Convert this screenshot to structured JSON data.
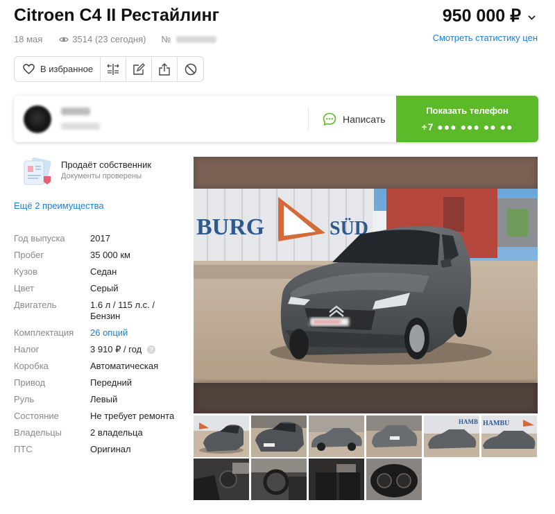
{
  "listing": {
    "title": "Citroen C4 II Рестайлинг",
    "price": "950 000 ₽",
    "price_stats_link": "Смотреть статистику цен",
    "date": "18 мая",
    "views": "3514 (23 сегодня)",
    "number_prefix": "№"
  },
  "actions": {
    "favorite_label": "В избранное",
    "icons": [
      "compare-icon",
      "note-icon",
      "share-icon",
      "block-icon"
    ]
  },
  "seller": {
    "write_label": "Написать",
    "show_phone_label": "Показать телефон",
    "phone_masked": "+7 ●●● ●●● ●● ●●"
  },
  "owner": {
    "title": "Продаёт собственник",
    "subtitle": "Документы проверены",
    "more_link": "Ещё 2 преимущества"
  },
  "specs": [
    {
      "key": "Год выпуска",
      "value": "2017"
    },
    {
      "key": "Пробег",
      "value": "35 000 км"
    },
    {
      "key": "Кузов",
      "value": "Седан"
    },
    {
      "key": "Цвет",
      "value": "Серый"
    },
    {
      "key": "Двигатель",
      "value": "1.6 л / 115 л.с. /",
      "value2": "Бензин"
    },
    {
      "key": "Комплектация",
      "value": "26 опций"
    },
    {
      "key": "Налог",
      "value": "3 910 ₽ / год"
    },
    {
      "key": "Коробка",
      "value": "Автоматическая"
    },
    {
      "key": "Привод",
      "value": "Передний"
    },
    {
      "key": "Руль",
      "value": "Левый"
    },
    {
      "key": "Состояние",
      "value": "Не требует ремонта"
    },
    {
      "key": "Владельцы",
      "value": "2 владельца"
    },
    {
      "key": "ПТС",
      "value": "Оригинал"
    }
  ],
  "photo": {
    "banner_text_left": "BURG",
    "banner_text_right": "SÜD"
  },
  "colors": {
    "accent_green": "#5cb929",
    "link_blue": "#1a7fd4",
    "car_gray": "#5a5d60"
  }
}
